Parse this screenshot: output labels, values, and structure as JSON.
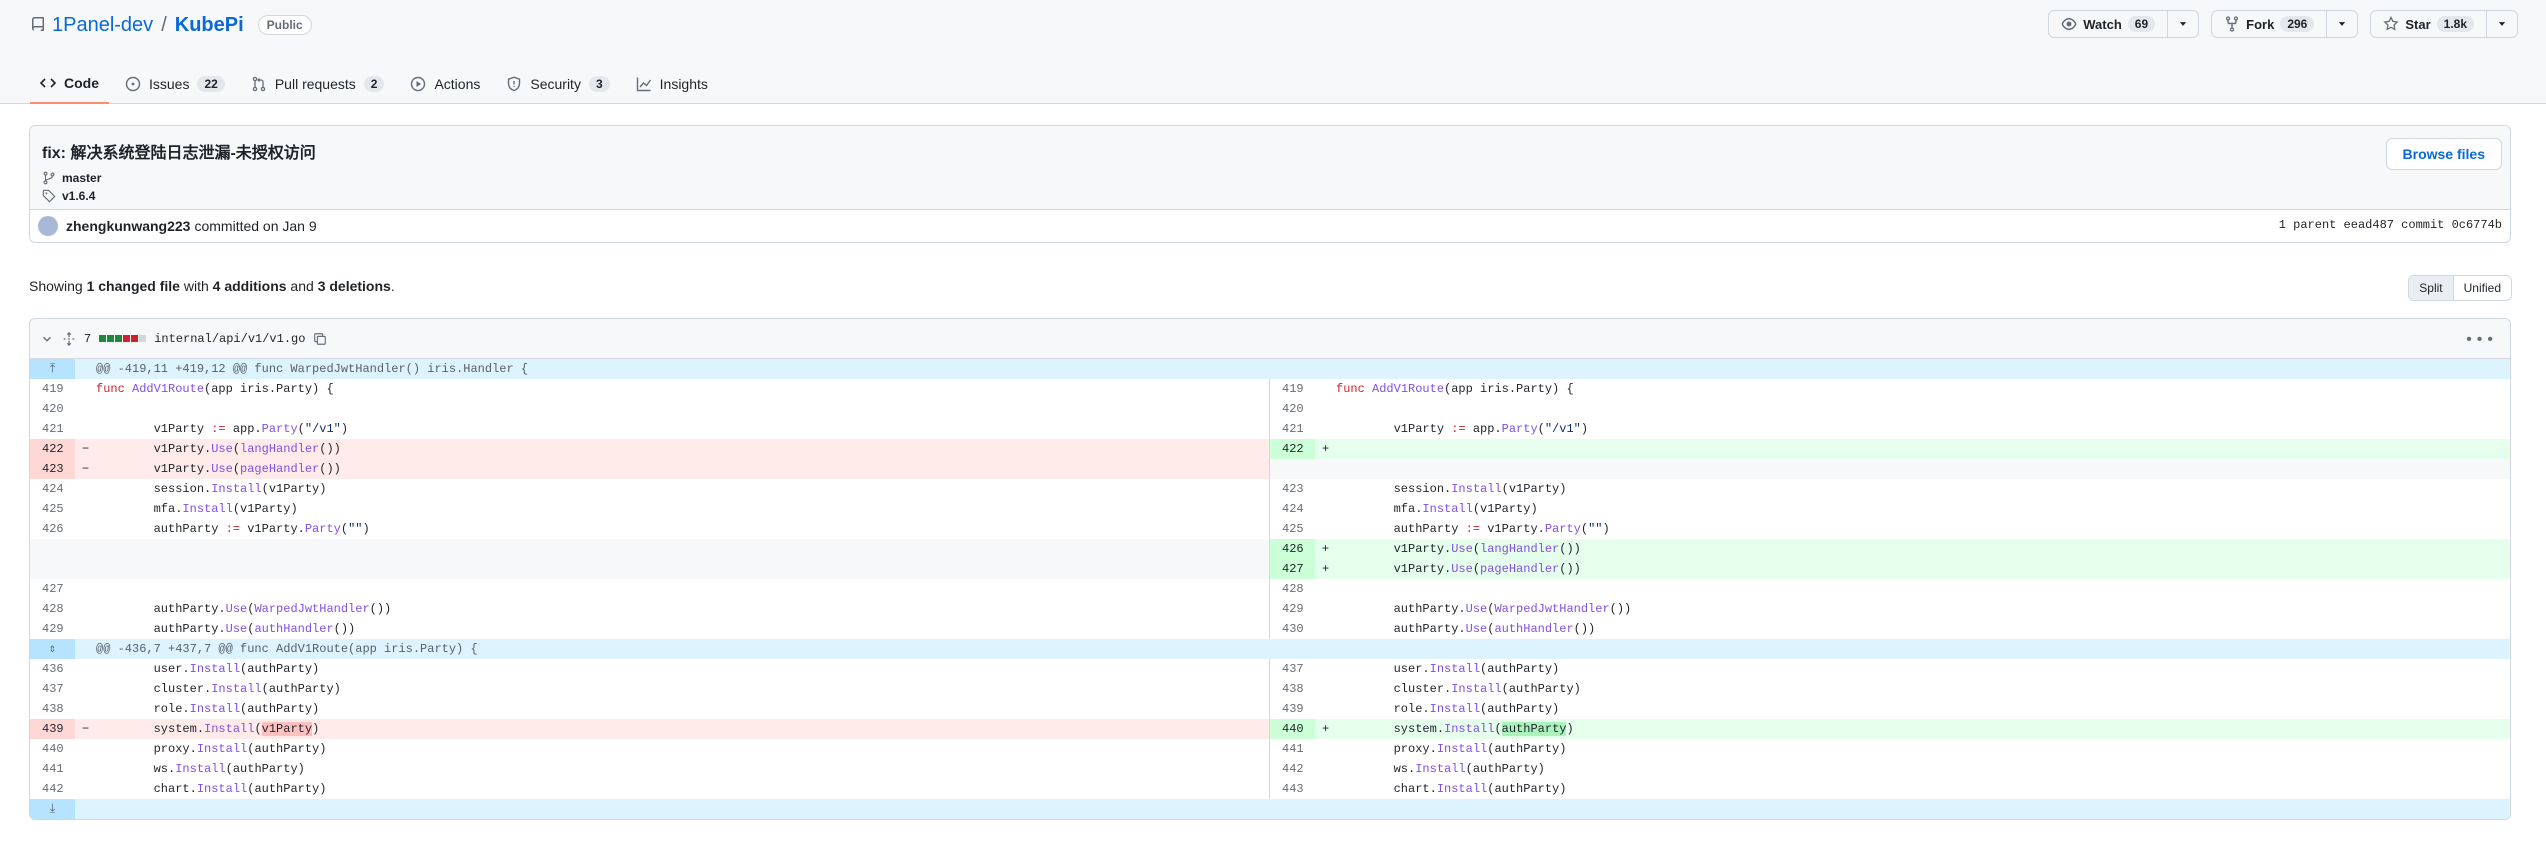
{
  "repo": {
    "owner": "1Panel-dev",
    "separator": "/",
    "name": "KubePi",
    "visibility": "Public"
  },
  "actions": {
    "watch": {
      "label": "Watch",
      "count": "69"
    },
    "fork": {
      "label": "Fork",
      "count": "296"
    },
    "star": {
      "label": "Star",
      "count": "1.8k"
    }
  },
  "tabs": [
    {
      "label": "Code",
      "count": ""
    },
    {
      "label": "Issues",
      "count": "22"
    },
    {
      "label": "Pull requests",
      "count": "2"
    },
    {
      "label": "Actions",
      "count": ""
    },
    {
      "label": "Security",
      "count": "3"
    },
    {
      "label": "Insights",
      "count": ""
    }
  ],
  "commit": {
    "title": "fix: 解决系统登陆日志泄漏-未授权访问",
    "branch": "master",
    "tag": "v1.6.4",
    "browse_label": "Browse files",
    "author": "zhengkunwang223",
    "committed_text": "committed on Jan 9",
    "parent_meta": "1 parent eead487  commit 0c6774b"
  },
  "summary": {
    "p1": "Showing ",
    "b1": "1 changed file",
    "p2": " with ",
    "b2": "4 additions",
    "p3": " and ",
    "b3": "3 deletions",
    "p4": "."
  },
  "view": {
    "split": "Split",
    "unified": "Unified"
  },
  "file": {
    "changes": "7",
    "path": "internal/api/v1/v1.go"
  },
  "hunks": [
    "@@ -419,11 +419,12 @@ func WarpedJwtHandler() iris.Handler {",
    "@@ -436,7 +437,7 @@ func AddV1Route(app iris.Party) {"
  ],
  "lines": {
    "l419": "419",
    "r419": "419",
    "c419": "func AddV1Route(app iris.Party) {",
    "l420": "420",
    "r420": "420",
    "l421": "421",
    "r421": "421",
    "c421": "        v1Party := app.Party(\"/v1\")",
    "l422": "422",
    "r422": "422",
    "c422": "        v1Party.Use(langHandler())",
    "l423": "423",
    "c423": "        v1Party.Use(pageHandler())",
    "l424": "424",
    "r423": "423",
    "c424": "        session.Install(v1Party)",
    "l425": "425",
    "r424": "424",
    "c425": "        mfa.Install(v1Party)",
    "l426": "426",
    "r425": "425",
    "c426": "        authParty := v1Party.Party(\"\")",
    "r426": "426",
    "r427": "427",
    "l427": "427",
    "r428": "428",
    "l428": "428",
    "r429": "429",
    "c428": "        authParty.Use(WarpedJwtHandler())",
    "l429": "429",
    "r430": "430",
    "c429": "        authParty.Use(authHandler())",
    "l436": "436",
    "r437": "437",
    "c436": "        user.Install(authParty)",
    "l437": "437",
    "r438": "438",
    "c437": "        cluster.Install(authParty)",
    "l438": "438",
    "r439": "439",
    "c438": "        role.Install(authParty)",
    "l439": "439",
    "r440": "440",
    "c439l": "        system.Install(v1Party)",
    "c439r": "        system.Install(authParty)",
    "l440": "440",
    "r441": "441",
    "c440": "        proxy.Install(authParty)",
    "l441": "441",
    "r442": "442",
    "c441": "        ws.Install(authParty)",
    "l442": "442",
    "r443": "443",
    "c442": "        chart.Install(authParty)",
    "minus": "−",
    "plus": "+"
  },
  "colors": {
    "accent": "#0969da",
    "added": "#e6ffec",
    "deleted": "#ffebe9",
    "hunk": "#ddf4ff"
  }
}
